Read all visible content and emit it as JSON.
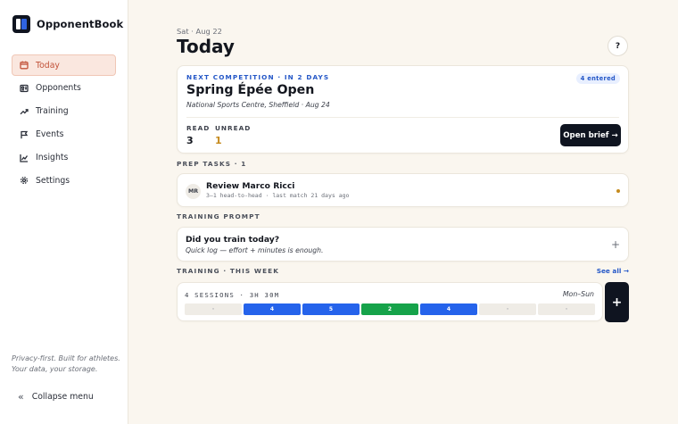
{
  "app": {
    "name": "OpponentBook"
  },
  "sidebar": {
    "items": [
      {
        "label": "Today",
        "icon": "calendar-icon",
        "active": true
      },
      {
        "label": "Opponents",
        "icon": "id-card-icon",
        "active": false
      },
      {
        "label": "Training",
        "icon": "trend-up-icon",
        "active": false
      },
      {
        "label": "Events",
        "icon": "flag-icon",
        "active": false
      },
      {
        "label": "Insights",
        "icon": "line-chart-icon",
        "active": false
      },
      {
        "label": "Settings",
        "icon": "gear-icon",
        "active": false
      }
    ],
    "footer_line1": "Privacy-first. Built for athletes.",
    "footer_line2": "Your data, your storage.",
    "collapse_icon": "«",
    "collapse_label": "Collapse menu"
  },
  "header": {
    "date": "Sat · Aug 22",
    "title": "Today",
    "help_label": "?"
  },
  "competition": {
    "eyebrow": "NEXT COMPETITION · IN 2 DAYS",
    "badge": "4 entered",
    "title": "Spring Épée Open",
    "venue": "National Sports Centre, Sheffield · Aug  24",
    "read_label": "READ",
    "read_value": "3",
    "unread_label": "UNREAD",
    "unread_value": "1",
    "open_brief_label": "Open brief →"
  },
  "prep_tasks": {
    "label": "PREP TASKS · 1",
    "items": [
      {
        "initials": "MR",
        "title": "Review Marco Ricci",
        "subtitle": "3–1 head-to-head · last match 21 days ago"
      }
    ]
  },
  "training_prompt": {
    "label": "TRAINING PROMPT",
    "title": "Did you train today?",
    "subtitle": "Quick log — effort + minutes is enough.",
    "add_label": "+"
  },
  "training_week": {
    "label": "TRAINING · THIS WEEK",
    "see_all": "See all →",
    "summary": "4 SESSIONS · 3H 30M",
    "range": "Mon–Sun",
    "days": [
      {
        "value": "·",
        "color": "#efece6",
        "text_color": "#9a9ea6"
      },
      {
        "value": "4",
        "color": "#2563eb",
        "text_color": "#ffffff"
      },
      {
        "value": "5",
        "color": "#2563eb",
        "text_color": "#ffffff"
      },
      {
        "value": "2",
        "color": "#16a34a",
        "text_color": "#ffffff"
      },
      {
        "value": "4",
        "color": "#2563eb",
        "text_color": "#ffffff"
      },
      {
        "value": "·",
        "color": "#efece6",
        "text_color": "#9a9ea6"
      },
      {
        "value": "·",
        "color": "#efece6",
        "text_color": "#9a9ea6"
      }
    ],
    "add_label": "+"
  },
  "colors": {
    "accent": "#c2533a",
    "primary_dark": "#0f1420",
    "link_blue": "#2457c7",
    "unread_amber": "#c58a1d",
    "background": "#faf6ef"
  }
}
